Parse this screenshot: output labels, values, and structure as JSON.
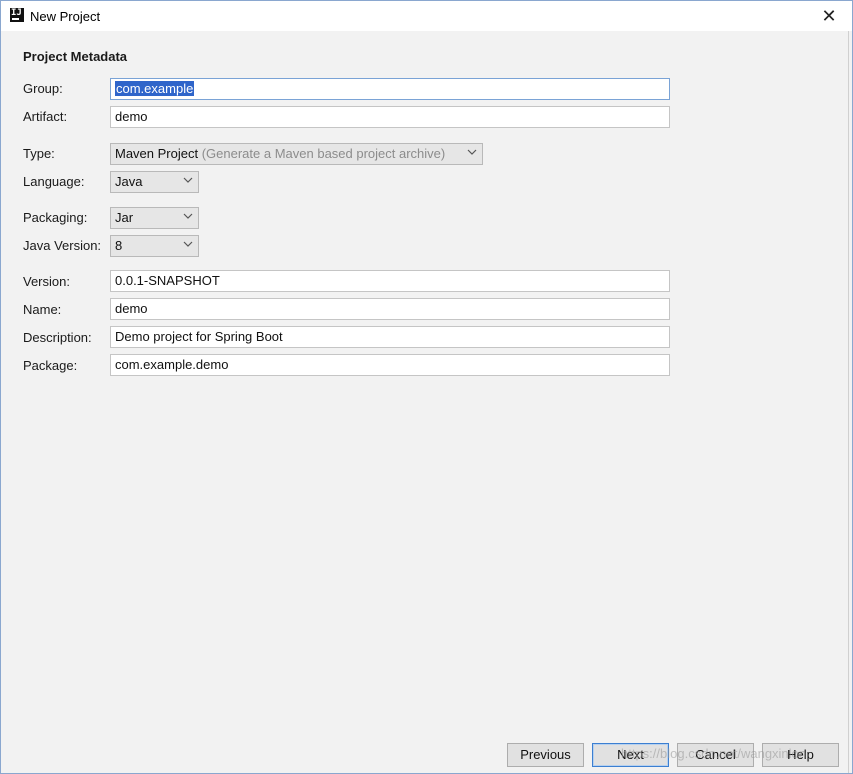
{
  "window": {
    "title": "New Project",
    "app_icon_text": "IJ",
    "close_glyph": "✕"
  },
  "form": {
    "section_title": "Project Metadata",
    "group": {
      "label": "Group:",
      "value_selected": "com.example"
    },
    "artifact": {
      "label": "Artifact:",
      "value": "demo"
    },
    "type": {
      "label": "Type:",
      "value": "Maven Project",
      "hint": "(Generate a Maven based project archive)"
    },
    "language": {
      "label": "Language:",
      "value": "Java"
    },
    "packaging": {
      "label": "Packaging:",
      "value": "Jar"
    },
    "java_version": {
      "label": "Java Version:",
      "value": "8"
    },
    "version": {
      "label": "Version:",
      "value": "0.0.1-SNAPSHOT"
    },
    "name": {
      "label": "Name:",
      "value": "demo"
    },
    "description": {
      "label": "Description:",
      "value": "Demo project for Spring Boot"
    },
    "package": {
      "label": "Package:",
      "value": "com.example.demo"
    }
  },
  "buttons": {
    "previous": "Previous",
    "next": "Next",
    "cancel": "Cancel",
    "help": "Help"
  },
  "watermark": "https://blog.csdn.net/wangxinlon",
  "colors": {
    "selection": "#2f65ca",
    "focus_border": "#7aa3d6",
    "default_button_border": "#3c7fd1"
  }
}
